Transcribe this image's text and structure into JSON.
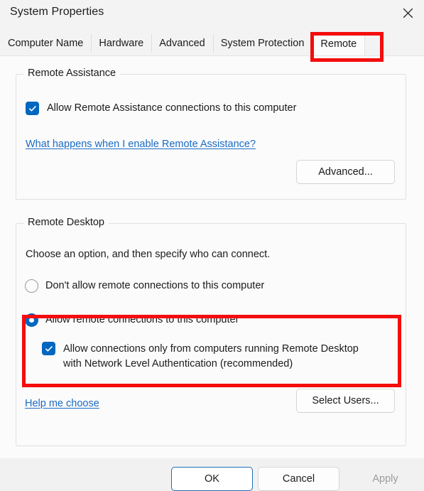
{
  "window": {
    "title": "System Properties",
    "close_icon": "close-icon"
  },
  "tabs": [
    {
      "label": "Computer Name",
      "selected": false
    },
    {
      "label": "Hardware",
      "selected": false
    },
    {
      "label": "Advanced",
      "selected": false
    },
    {
      "label": "System Protection",
      "selected": false
    },
    {
      "label": "Remote",
      "selected": true
    }
  ],
  "remote_assistance": {
    "group_title": "Remote Assistance",
    "checkbox": {
      "label": "Allow Remote Assistance connections to this computer",
      "checked": true
    },
    "link": "What happens when I enable Remote Assistance?",
    "advanced_button": "Advanced..."
  },
  "remote_desktop": {
    "group_title": "Remote Desktop",
    "instruction": "Choose an option, and then specify who can connect.",
    "options": [
      {
        "label": "Don't allow remote connections to this computer",
        "selected": false
      },
      {
        "label": "Allow remote connections to this computer",
        "selected": true
      }
    ],
    "nla_checkbox": {
      "label": "Allow connections only from computers running Remote Desktop with Network Level Authentication (recommended)",
      "checked": true
    },
    "link": "Help me choose",
    "select_users_button": "Select Users..."
  },
  "footer": {
    "ok": "OK",
    "cancel": "Cancel",
    "apply": "Apply",
    "apply_disabled": true
  },
  "colors": {
    "accent": "#0067c0",
    "link": "#1a6bc4",
    "annotation": "#f40d0d",
    "default_button_border": "#1f6fb4",
    "window_background": "#f3f3f3",
    "panel_background": "#fbfbfb",
    "disabled_text": "#9b9b9b"
  },
  "annotations": [
    {
      "target": "remote-tab",
      "color": "#f40d0d"
    },
    {
      "target": "allow-remote-connections-group",
      "color": "#f40d0d"
    }
  ]
}
